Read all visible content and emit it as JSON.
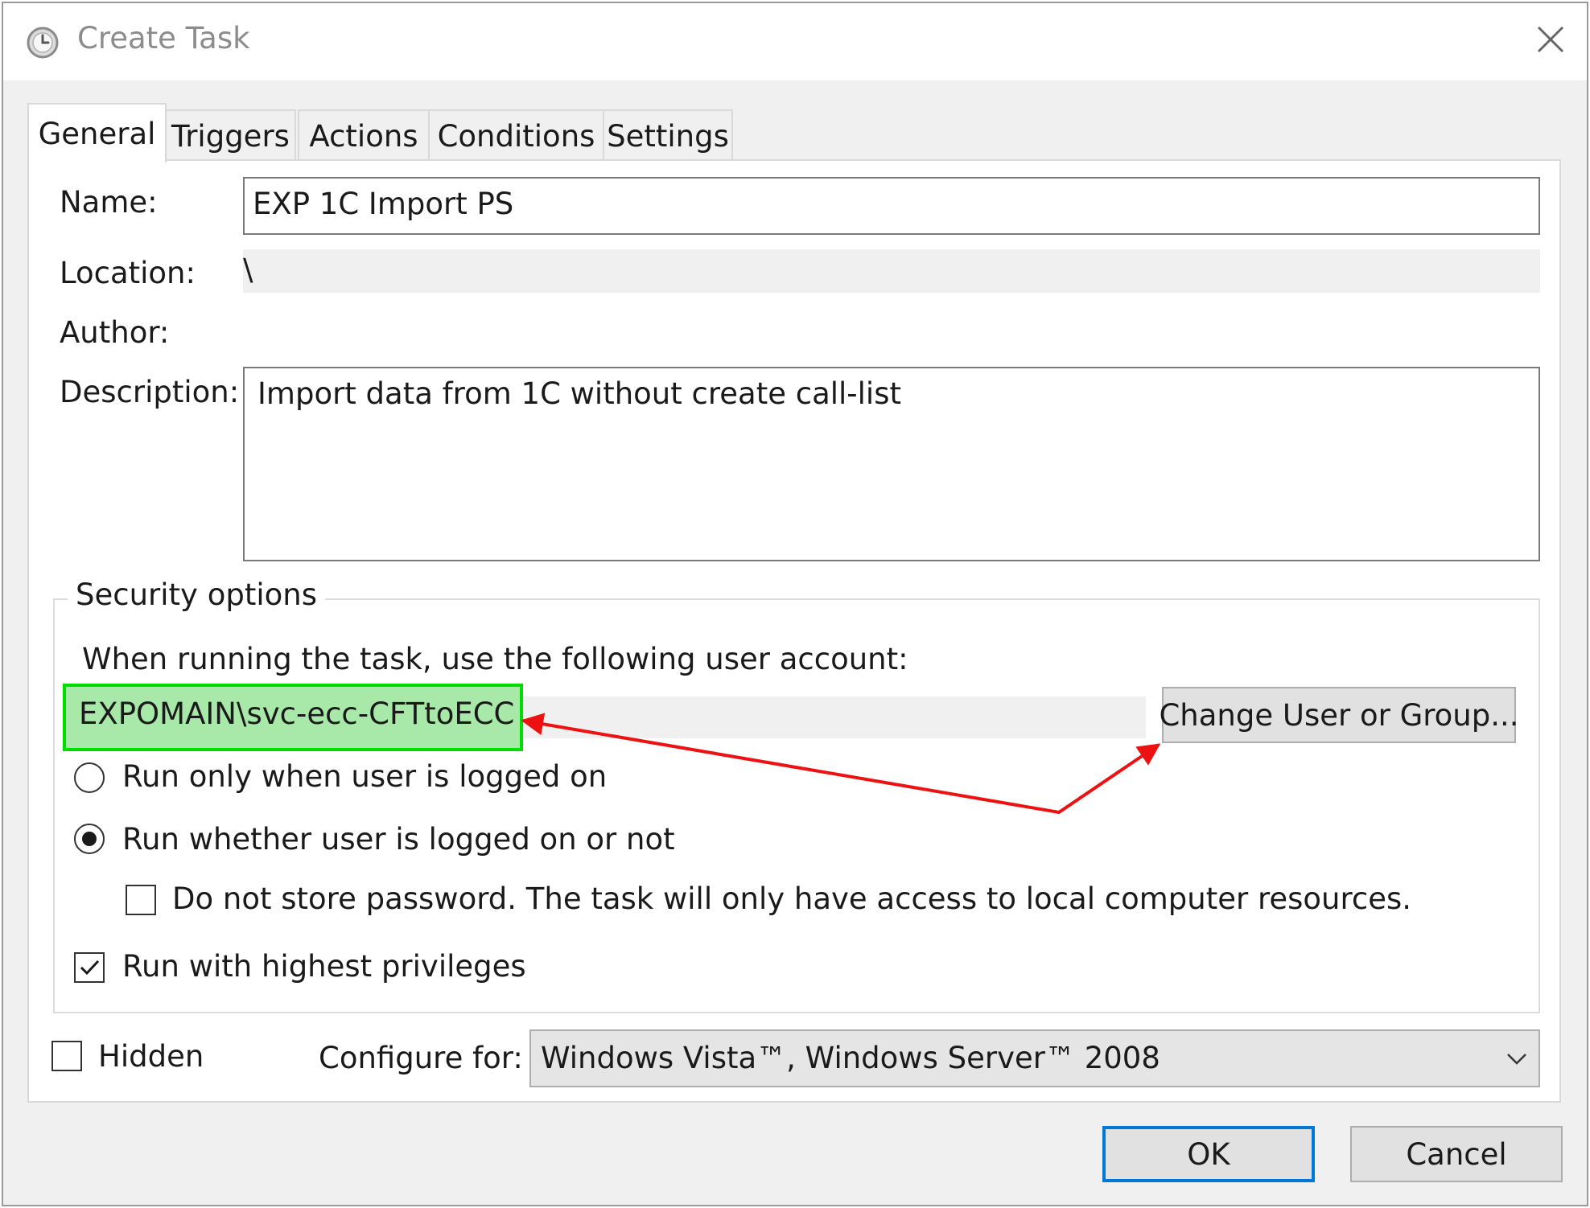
{
  "window": {
    "title": "Create Task",
    "icon": "clock-icon",
    "close_icon": "close-icon"
  },
  "tabs": [
    {
      "label": "General",
      "active": true
    },
    {
      "label": "Triggers",
      "active": false
    },
    {
      "label": "Actions",
      "active": false
    },
    {
      "label": "Conditions",
      "active": false
    },
    {
      "label": "Settings",
      "active": false
    }
  ],
  "general": {
    "name_label": "Name:",
    "name_value": "EXP 1C Import PS",
    "location_label": "Location:",
    "location_value": "\\",
    "author_label": "Author:",
    "author_value": "",
    "description_label": "Description:",
    "description_value": "Import data from 1C without create call-list"
  },
  "security": {
    "group_title": "Security options",
    "account_prompt": "When running the task, use the following user account:",
    "account_value": "EXPOMAIN\\svc-ecc-CFTtoECC",
    "change_button": "Change User or Group...",
    "run_only_logged_on": {
      "label": "Run only when user is logged on",
      "checked": false
    },
    "run_whether_logged_on": {
      "label": "Run whether user is logged on or not",
      "checked": true
    },
    "do_not_store_password": {
      "label": "Do not store password.  The task will only have access to local computer resources.",
      "checked": false
    },
    "run_highest_privileges": {
      "label": "Run with highest privileges",
      "checked": true
    }
  },
  "bottom": {
    "hidden": {
      "label": "Hidden",
      "checked": false
    },
    "configure_label": "Configure for:",
    "configure_value": "Windows Vista™, Windows Server™ 2008"
  },
  "buttons": {
    "ok": "OK",
    "cancel": "Cancel"
  },
  "annotations": {
    "highlight_color": "#00dd00",
    "highlight_fill": "#a8e8a8",
    "arrow_color": "#ee1111"
  },
  "colors": {
    "default_button_border": "#0078d7"
  }
}
